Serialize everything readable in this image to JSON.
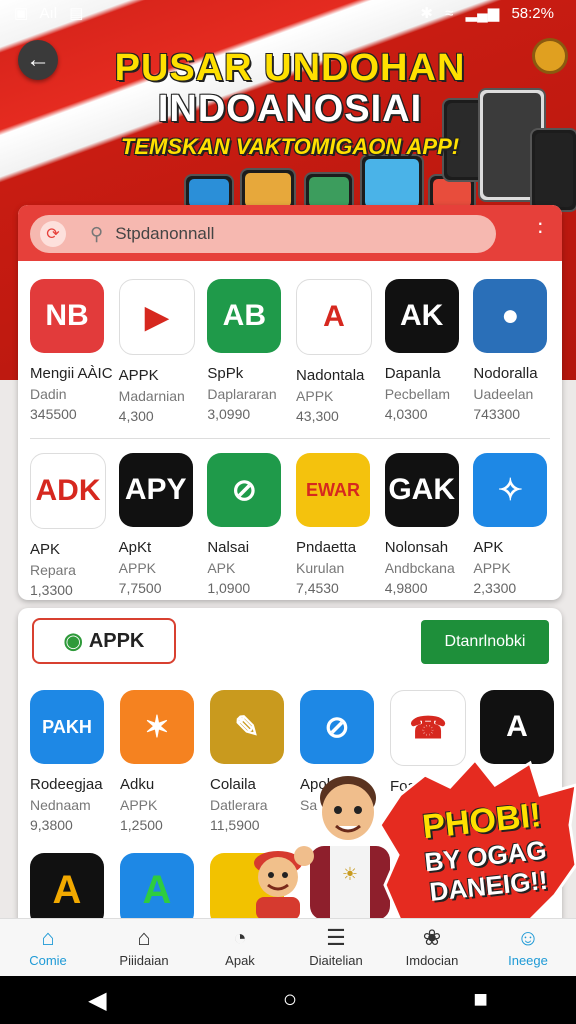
{
  "status_bar": {
    "left_icons": [
      "AI",
      "A",
      "image"
    ],
    "left_text": "Aıl",
    "battery": "58:2%"
  },
  "banner": {
    "title_line1": "PUSAR UNDOHAN",
    "title_line2": "INDOANOSIAI",
    "subtitle": "TEMSKAN VAKTOMIGAON APP!",
    "colors": {
      "red": "#d9251c",
      "yellow": "#ffe000"
    }
  },
  "search": {
    "placeholder": "Stpdanonnall"
  },
  "apps_row1": [
    {
      "icon_text": "NB",
      "name": "Mengii AÀIC",
      "sub": "Dadin",
      "count": "345500",
      "color": "#e23b3b"
    },
    {
      "icon_text": "▶",
      "name": "APPK",
      "sub": "Madarnian",
      "count": "4,300",
      "color": "#ffffff"
    },
    {
      "icon_text": "AB",
      "name": "SpPk",
      "sub": "Daplararan",
      "count": "3,0990",
      "color": "#1f9a4a"
    },
    {
      "icon_text": "A",
      "name": "Nadontala",
      "sub": "APPK",
      "count": "43,300",
      "color": "#ffffff"
    },
    {
      "icon_text": "AK",
      "name": "Dapanla",
      "sub": "Pecbellam",
      "count": "4,0300",
      "color": "#111111"
    },
    {
      "icon_text": "●",
      "name": "Nodoralla",
      "sub": "Uadeelan",
      "count": "743300",
      "color": "#2a6fb8"
    }
  ],
  "apps_row2": [
    {
      "icon_text": "ADK",
      "name": "APK",
      "sub": "Repara",
      "count": "1,3300",
      "color": "#ffffff"
    },
    {
      "icon_text": "APY",
      "name": "ApKt",
      "sub": "APPK",
      "count": "7,7500",
      "color": "#111111"
    },
    {
      "icon_text": "⊘",
      "name": "Nalsai",
      "sub": "APK",
      "count": "1,0900",
      "color": "#1f9a4a"
    },
    {
      "icon_text": "EWAR",
      "name": "Pndaetta",
      "sub": "Kurulan",
      "count": "7,4530",
      "color": "#f4c20d"
    },
    {
      "icon_text": "GAK",
      "name": "Nolonsah",
      "sub": "Andbckana",
      "count": "4,9800",
      "color": "#111111"
    },
    {
      "icon_text": "✧",
      "name": "APK",
      "sub": "APPK",
      "count": "2,3300",
      "color": "#1e88e5"
    }
  ],
  "section2": {
    "brand_label": "APPK",
    "download_label": "Dtanrlnobki"
  },
  "apps_row3": [
    {
      "icon_text": "PAKH",
      "name": "Rodeegjaa",
      "sub": "Nednaam",
      "count": "9,3800",
      "color": "#1e88e5"
    },
    {
      "icon_text": "✶",
      "name": "Adku",
      "sub": "APPK",
      "count": "1,2500",
      "color": "#f58220"
    },
    {
      "icon_text": "✎",
      "name": "Colaila",
      "sub": "Datlerara",
      "count": "11,5900",
      "color": "#c99a1e"
    },
    {
      "icon_text": "⊘",
      "name": "Apol",
      "sub": "Sa",
      "count": "",
      "color": "#1e88e5"
    },
    {
      "icon_text": "☎",
      "name": "Foa",
      "sub": "",
      "count": "",
      "color": "#ffffff"
    },
    {
      "icon_text": "A",
      "name": "",
      "sub": "",
      "count": "",
      "color": "#111111"
    }
  ],
  "promo": {
    "line1": "PHOBI!",
    "line2": "BY OGAG",
    "line3": "DANEIG!!"
  },
  "bottom_nav": [
    {
      "icon": "home-icon",
      "glyph": "⌂",
      "label": "Comie",
      "active": true
    },
    {
      "icon": "store-icon",
      "glyph": "⌂",
      "label": "Piiidaian",
      "active": false
    },
    {
      "icon": "compass-icon",
      "glyph": "◔",
      "label": "Apak",
      "active": false
    },
    {
      "icon": "list-icon",
      "glyph": "☰",
      "label": "Diaitelian",
      "active": false
    },
    {
      "icon": "leaf-icon",
      "glyph": "❀",
      "label": "Imdocian",
      "active": false
    },
    {
      "icon": "person-icon",
      "glyph": "☺",
      "label": "Ineege",
      "active": true
    }
  ],
  "system_bar": {
    "back": "◀",
    "home": "○",
    "recents": "■"
  }
}
